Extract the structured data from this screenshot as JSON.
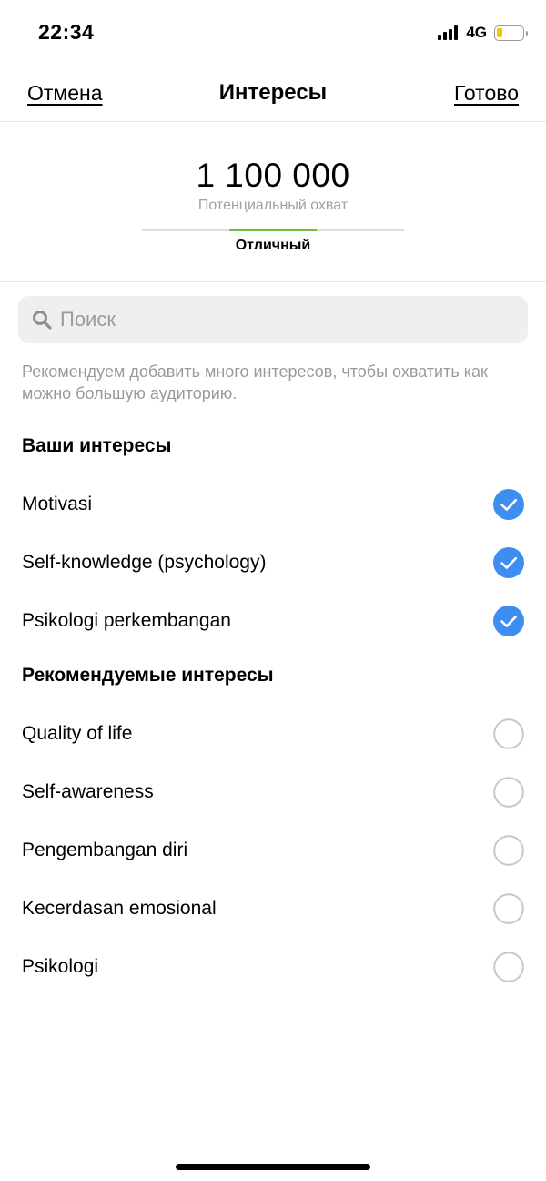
{
  "status_bar": {
    "time": "22:34",
    "network": "4G",
    "signal_icon": "signal-bars-icon",
    "battery_icon": "battery-low-icon",
    "battery_color": "#f5c400"
  },
  "nav": {
    "cancel_label": "Отмена",
    "title": "Интересы",
    "done_label": "Готово"
  },
  "reach": {
    "number": "1 100 000",
    "caption": "Потенциальный охват",
    "rating": "Отличный",
    "meter_segments": 3,
    "meter_active_segment": 2,
    "meter_active_color": "#6cbf42"
  },
  "search": {
    "placeholder": "Поиск",
    "value": ""
  },
  "hint": "Рекомендуем добавить много интересов, чтобы охватить как можно большую аудиторию.",
  "your_interests": {
    "heading": "Ваши интересы",
    "items": [
      {
        "label": "Motivasi",
        "checked": true
      },
      {
        "label": "Self-knowledge (psychology)",
        "checked": true
      },
      {
        "label": "Psikologi perkembangan",
        "checked": true
      }
    ]
  },
  "recommended_interests": {
    "heading": "Рекомендуемые интересы",
    "items": [
      {
        "label": "Quality of life",
        "checked": false
      },
      {
        "label": "Self-awareness",
        "checked": false
      },
      {
        "label": "Pengembangan diri",
        "checked": false
      },
      {
        "label": "Kecerdasan emosional",
        "checked": false
      },
      {
        "label": "Psikologi",
        "checked": false
      }
    ]
  },
  "colors": {
    "check_blue": "#3d8ef0",
    "circle_gray": "#c7c7c7"
  }
}
